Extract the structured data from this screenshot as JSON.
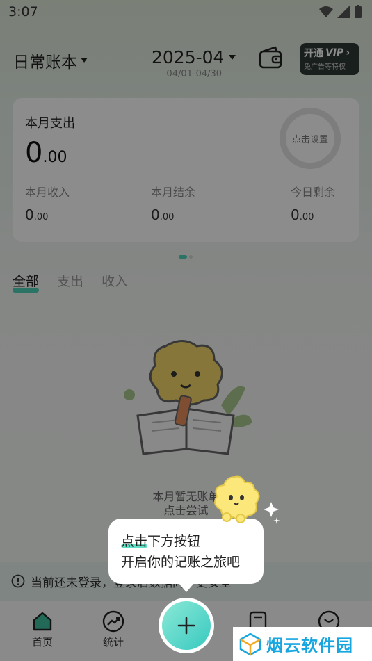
{
  "status_bar": {
    "time": "3:07"
  },
  "header": {
    "book_name": "日常账本",
    "month": "2025-04",
    "date_range": "04/01-04/30",
    "vip_title": "开通",
    "vip_tag": "VIP",
    "vip_arrow": "›",
    "vip_subtitle": "免广告等特权"
  },
  "summary": {
    "expense_label": "本月支出",
    "expense_int": "0",
    "expense_dec": ".00",
    "budget_ring_label": "点击设置",
    "stats": [
      {
        "label": "本月收入",
        "int": "0",
        "dec": ".00"
      },
      {
        "label": "本月结余",
        "int": "0",
        "dec": ".00"
      },
      {
        "label": "今日剩余",
        "int": "0",
        "dec": ".00"
      }
    ]
  },
  "tabs": [
    {
      "label": "全部",
      "active": true
    },
    {
      "label": "支出",
      "active": false
    },
    {
      "label": "收入",
      "active": false
    }
  ],
  "empty_state": {
    "line1": "本月暂无账单",
    "line2": "点击尝试"
  },
  "login_banner": {
    "text": "当前还未登录，登录后数据同步更安全"
  },
  "tabbar": {
    "items": [
      {
        "label": "首页",
        "icon": "home-icon"
      },
      {
        "label": "统计",
        "icon": "trend-icon"
      },
      {
        "label": "",
        "icon": "plus-icon"
      },
      {
        "label": "",
        "icon": "bill-icon"
      },
      {
        "label": "",
        "icon": "profile-icon"
      }
    ]
  },
  "guide_bubble": {
    "line1_hl": "点击",
    "line1_rest": "下方按钮",
    "line2": "开启你的记账之旅吧"
  },
  "watermark": {
    "text": "烟云软件园"
  },
  "colors": {
    "accent": "#4fd1b9",
    "vip_bg": "#2d3a35",
    "overlay": "rgba(0,0,0,0.45)"
  }
}
